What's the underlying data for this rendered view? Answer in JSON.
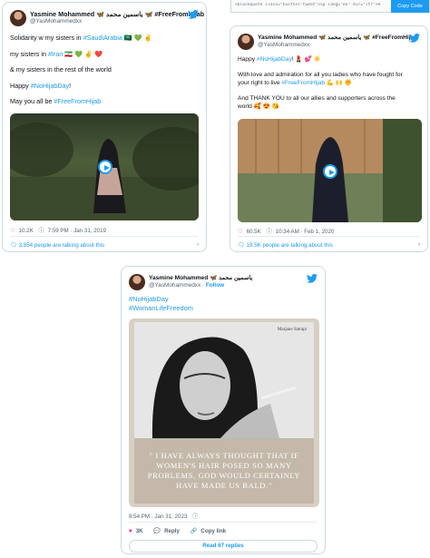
{
  "embed_toolbar": {
    "code": "<blockquote class=\"twitter-tweet\"><p lang=\"en\" dir=\"ltr\">Happy <a href",
    "copy_label": "Copy Code"
  },
  "tweet1": {
    "name": "Yasmine Mohammed 🦋 یاسمین محمد 🦋 #FreeFromHijab",
    "handle": "@YasMohammedxx",
    "lines": [
      {
        "pre": "Solidarity w my sisters in ",
        "tag": "#SaudiArabia",
        "post": " 🇸🇦 💚 ✌️"
      },
      {
        "pre": "my sisters in ",
        "tag": "#Iran",
        "post": " 🇮🇷 💚 ✌️ ❤️"
      },
      {
        "pre": "& my sisters in the rest of the world",
        "tag": "",
        "post": ""
      },
      {
        "pre": "Happy ",
        "tag": "#NoHijabDay",
        "post": "!"
      },
      {
        "pre": "May you all be ",
        "tag": "#FreeFromHijab",
        "post": ""
      }
    ],
    "likes": "10.2K",
    "time": "7:59 PM · Jan 31, 2019",
    "talking": "3,854 people are talking about this"
  },
  "tweet2": {
    "name": "Yasmine Mohammed 🦋 یاسمین محمد 🦋 #FreeFromHijab",
    "handle": "@YasMohammedxx",
    "lines": [
      {
        "pre": "Happy ",
        "tag": "#NoHijabDay",
        "post": "! 💄 💕 ☀️"
      },
      {
        "pre": "With love and admiration for all you ladies who have fought for",
        "tag": "",
        "post": ""
      },
      {
        "pre": "your right to live ",
        "tag": "#FreeFromHijab",
        "post": " 💪 🙌 ✊"
      },
      {
        "pre": "And THANK YOU to all our allies and supporters across the",
        "tag": "",
        "post": ""
      },
      {
        "pre": "world 🥰 😍 😘",
        "tag": "",
        "post": ""
      }
    ],
    "likes": "60.5K",
    "time": "10:34 AM · Feb 1, 2020",
    "talking": "19.5K people are talking about this"
  },
  "tweet3": {
    "name": "Yasmine Mohammed 🦋 یاسمین محمد",
    "handle": "@YasMohammedxx",
    "follow": "Follow",
    "tags": [
      "#NoHijabDay",
      "#WomanLifeFreedom"
    ],
    "photo_caption": "Marjane Satrapi",
    "quote": "\" I HAVE ALWAYS THOUGHT THAT IF WOMEN'S HAIR POSED SO MANY PROBLEMS, GOD WOULD CERTAINLY HAVE MADE US BALD.\"",
    "time": "8:54 PM · Jan 31, 2023",
    "likes": "3K",
    "reply": "Reply",
    "copy_link": "Copy link",
    "read_replies": "Read 67 replies"
  },
  "colors": {
    "accent": "#1d9bf0",
    "like": "#f91880",
    "quote_bg": "#c3b8a9"
  }
}
